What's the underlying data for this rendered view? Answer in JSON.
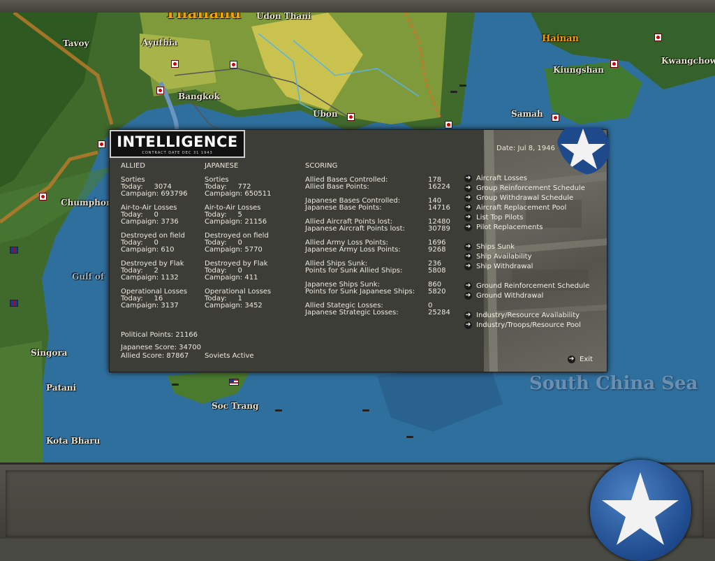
{
  "map": {
    "cities": [
      "Thailand",
      "Udon Thani",
      "Tavoy",
      "Ayuthia",
      "Bangkok",
      "Ubon",
      "Hainan",
      "Kiungshan",
      "Kwangchowan",
      "Samah",
      "Chumphon",
      "Gulf of",
      "Singora",
      "Patani",
      "Soc Trang",
      "Kota Bharu"
    ],
    "sea_label": "South China Sea"
  },
  "dialog": {
    "title": "INTELLIGENCE",
    "subtitle": "CONTRACT DATE  DEC 31 1943",
    "date": "Date: Jul 8, 1946",
    "allied": {
      "header": "ALLIED",
      "sorties": "Sorties",
      "sorties_today": "Today:     3074",
      "sorties_campaign": "Campaign: 693796",
      "a2a": "Air-to-Air Losses",
      "a2a_today": "Today:     0",
      "a2a_campaign": "Campaign: 3736",
      "dof": "Destroyed on field",
      "dof_today": "Today:     0",
      "dof_campaign": "Campaign: 610",
      "flak": "Destroyed by Flak",
      "flak_today": "Today:     2",
      "flak_campaign": "Campaign: 1132",
      "op": "Operational Losses",
      "op_today": "Today:     16",
      "op_campaign": "Campaign: 3137"
    },
    "japanese": {
      "header": "JAPANESE",
      "sorties": "Sorties",
      "sorties_today": "Today:     772",
      "sorties_campaign": "Campaign: 650511",
      "a2a": "Air-to-Air Losses",
      "a2a_today": "Today:     5",
      "a2a_campaign": "Campaign: 21156",
      "dof": "Destroyed on field",
      "dof_today": "Today:     0",
      "dof_campaign": "Campaign: 5770",
      "flak": "Destroyed by Flak",
      "flak_today": "Today:     0",
      "flak_campaign": "Campaign: 411",
      "op": "Operational Losses",
      "op_today": "Today:     1",
      "op_campaign": "Campaign: 3452"
    },
    "political_points": "Political Points: 21166",
    "japanese_score": "Japanese Score: 34700",
    "allied_score": "Allied Score: 87867",
    "soviets": "Soviets Active",
    "scoring": {
      "header": "SCORING",
      "rows": [
        {
          "label": "Allied Bases Controlled:",
          "value": "178"
        },
        {
          "label": "Allied Base Points:",
          "value": "16224"
        },
        {
          "label": "Japanese Bases Controlled:",
          "value": "140"
        },
        {
          "label": "Japanese Base Points:",
          "value": "14716"
        },
        {
          "label": "Allied Aircraft Points lost:",
          "value": "12480"
        },
        {
          "label": "Japanese Aircraft Points lost:",
          "value": "30789"
        },
        {
          "label": "Allied Army Loss Points:",
          "value": "1696"
        },
        {
          "label": "Japanese Army Loss Points:",
          "value": "9268"
        },
        {
          "label": "Allied Ships Sunk:",
          "value": "236"
        },
        {
          "label": "Points for Sunk Allied Ships:",
          "value": "5808"
        },
        {
          "label": "Japanese Ships Sunk:",
          "value": "860"
        },
        {
          "label": "Points for Sunk Japanese Ships:",
          "value": "5820"
        },
        {
          "label": "Allied Stategic Losses:",
          "value": "0"
        },
        {
          "label": "Japanese Strategic Losses:",
          "value": "25284"
        }
      ]
    },
    "links": [
      "Aircraft Losses",
      "Group Reinforcement Schedule",
      "Group Withdrawal Schedule",
      "Aircraft Replacement Pool",
      "List Top Pilots",
      "Pilot Replacements",
      "Ships Sunk",
      "Ship Availability",
      "Ship Withdrawal",
      "Ground Reinforcement Schedule",
      "Ground Withdrawal",
      "Industry/Resource Availability",
      "Industry/Troops/Resource Pool"
    ],
    "exit": "Exit"
  }
}
